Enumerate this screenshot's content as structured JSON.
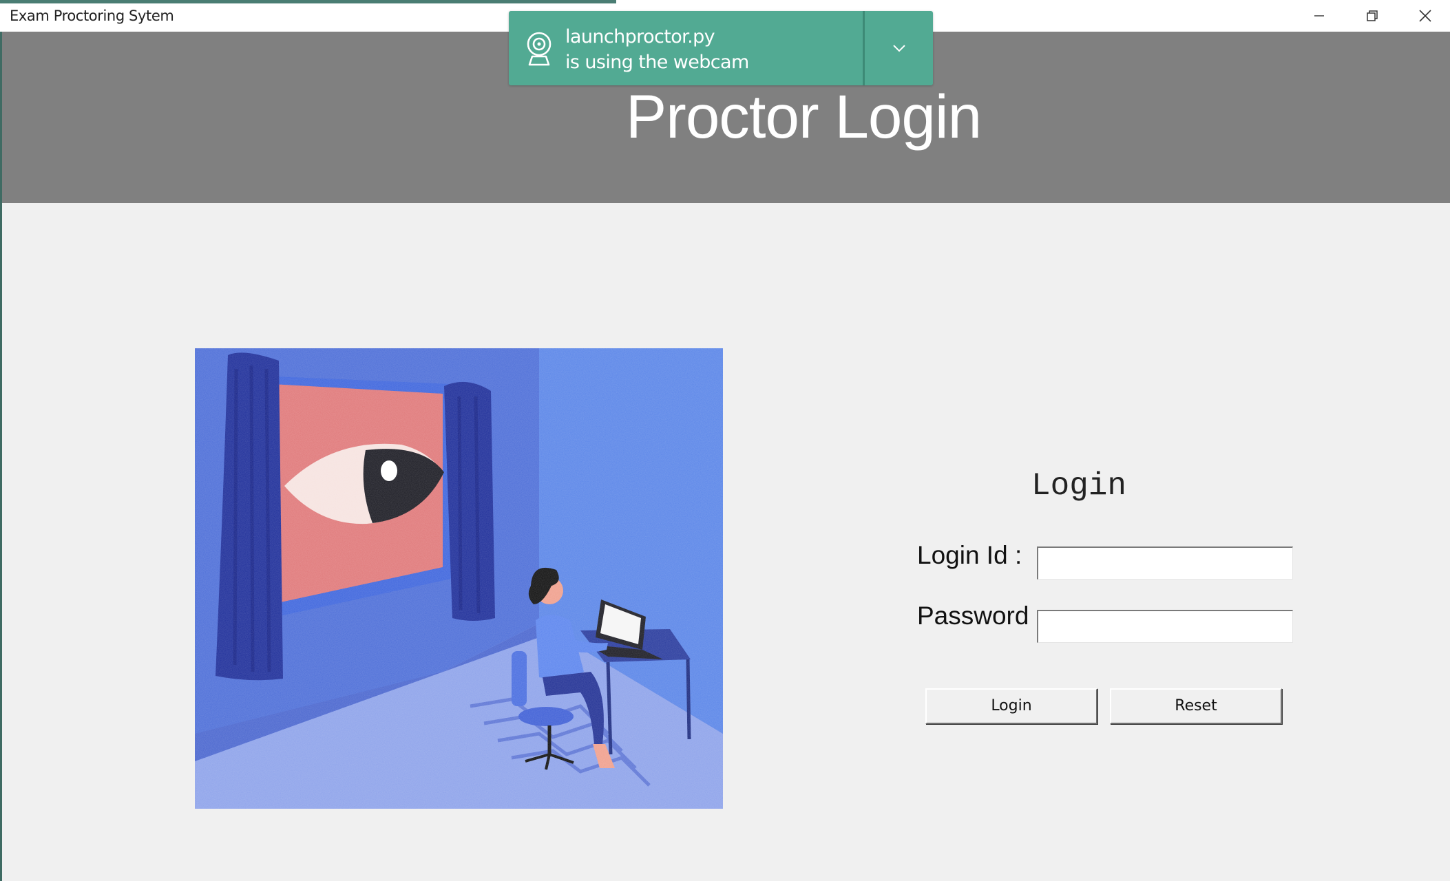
{
  "window": {
    "title": "Exam Proctoring Sytem",
    "controls": [
      "minimize-icon",
      "restore-icon",
      "close-icon"
    ]
  },
  "toast": {
    "app": "launchproctor.py",
    "message": "is using the webcam",
    "icon": "webcam-icon",
    "expand_icon": "chevron-down-icon",
    "color": "#52aa93"
  },
  "header": {
    "heading": "Proctor Login",
    "background": "#808080"
  },
  "illustration": {
    "subject": "person at laptop watched by giant eye in window"
  },
  "form": {
    "title": "Login",
    "login_id_label": "Login Id :",
    "login_id_value": "",
    "password_label": "Password :",
    "password_value": "",
    "login_button": "Login",
    "reset_button": "Reset"
  }
}
